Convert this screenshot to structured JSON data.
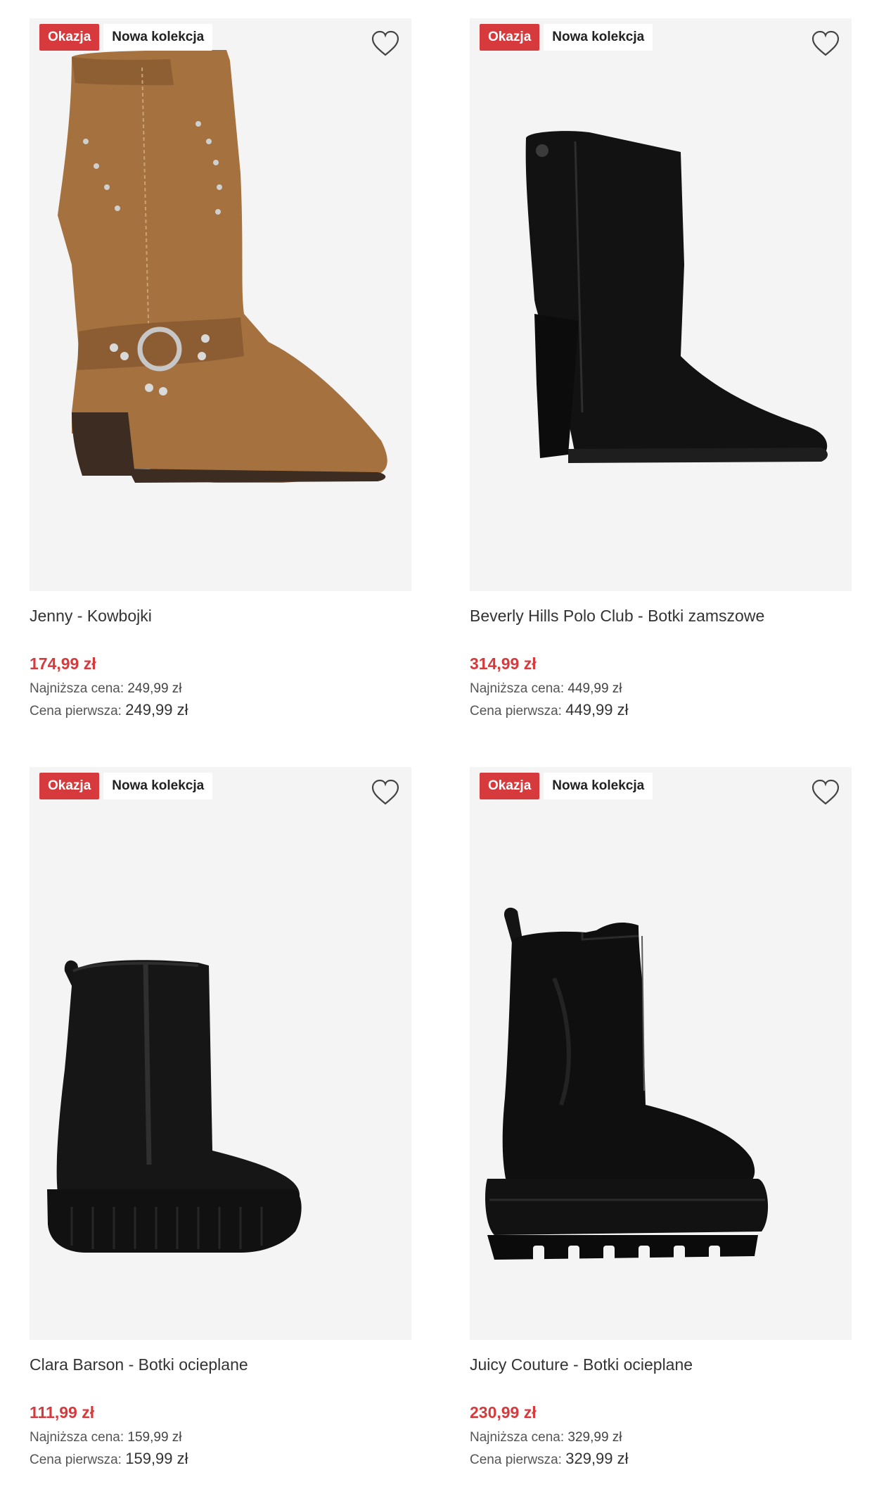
{
  "products": [
    {
      "badges": {
        "sale": "Okazja",
        "new": "Nowa kolekcja"
      },
      "name": "Jenny - Kowbojki",
      "price": "174,99 zł",
      "lowest_label": "Najniższa cena:",
      "lowest_value": "249,99 zł",
      "original_label": "Cena pierwsza:",
      "original_value": "249,99 zł",
      "image": "brown-western-boot"
    },
    {
      "badges": {
        "sale": "Okazja",
        "new": "Nowa kolekcja"
      },
      "name": "Beverly Hills Polo Club - Botki zamszowe",
      "price": "314,99 zł",
      "lowest_label": "Najniższa cena:",
      "lowest_value": "449,99 zł",
      "original_label": "Cena pierwsza:",
      "original_value": "449,99 zł",
      "image": "black-suede-heel-bootie"
    },
    {
      "badges": {
        "sale": "Okazja",
        "new": "Nowa kolekcja"
      },
      "name": "Clara Barson - Botki ocieplane",
      "price": "111,99 zł",
      "lowest_label": "Najniższa cena:",
      "lowest_value": "159,99 zł",
      "original_label": "Cena pierwsza:",
      "original_value": "159,99 zł",
      "image": "black-platform-ankle-boot"
    },
    {
      "badges": {
        "sale": "Okazja",
        "new": "Nowa kolekcja"
      },
      "name": "Juicy Couture - Botki ocieplane",
      "price": "230,99 zł",
      "lowest_label": "Najniższa cena:",
      "lowest_value": "329,99 zł",
      "original_label": "Cena pierwsza:",
      "original_value": "329,99 zł",
      "image": "black-leather-chunky-boot"
    }
  ],
  "colors": {
    "sale_red": "#d63a3c",
    "image_bg": "#f4f4f4"
  },
  "icons": {
    "favorite": "heart-outline-icon"
  }
}
